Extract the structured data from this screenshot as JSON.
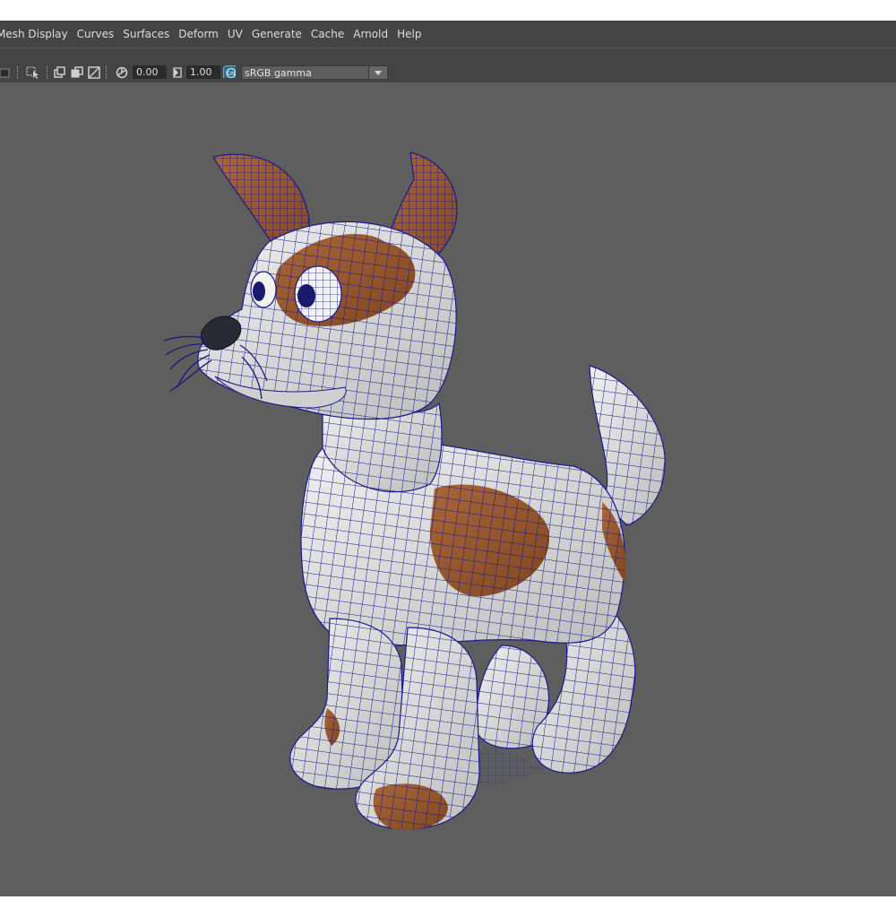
{
  "menubar": {
    "items": [
      "Mesh Display",
      "Curves",
      "Surfaces",
      "Deform",
      "UV",
      "Generate",
      "Cache",
      "Arnold",
      "Help"
    ]
  },
  "toolbar": {
    "exposure_value": "0.00",
    "gamma_value": "1.00",
    "color_space": "sRGB gamma",
    "colors": {
      "bg": "#444444",
      "field": "#2b2b2b",
      "icon": "#cfcfcf",
      "accent": "#4fb6d6"
    }
  },
  "viewport": {
    "background": "#5e5e5e",
    "model": {
      "subject": "cartoon-dog",
      "colors": {
        "fur": "#dcdcdc",
        "patch": "#9c5a2e",
        "wire": "#1a1a8a",
        "nose": "#2a2a34"
      }
    }
  }
}
